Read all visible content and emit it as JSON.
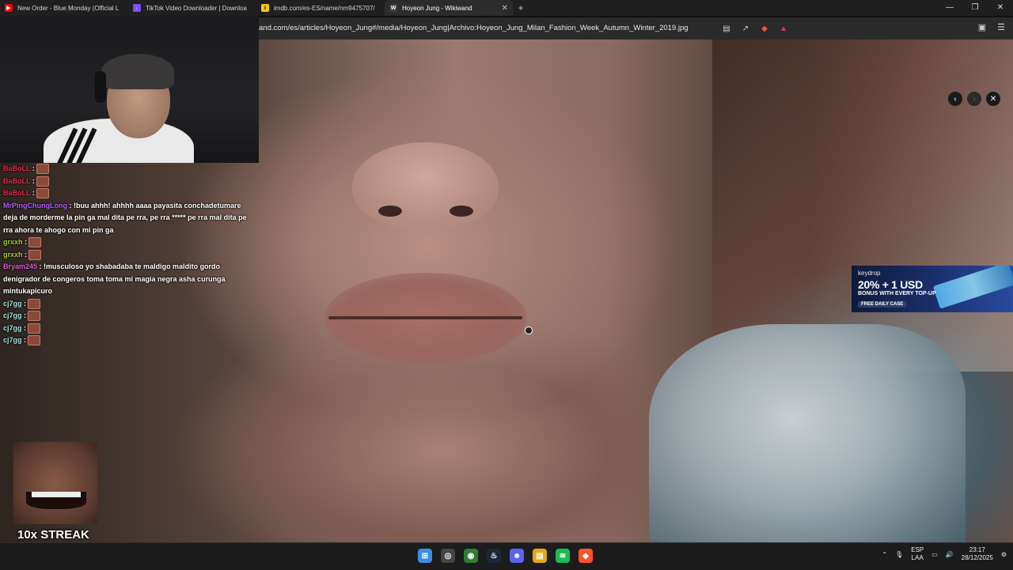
{
  "tabs": [
    {
      "title": "New Order - Blue Monday (Official L",
      "favicon": "youtube-icon",
      "color": "#ff0000"
    },
    {
      "title": "TikTok Video Downloader | Downloa",
      "favicon": "download-icon",
      "color": "#7b4bff"
    },
    {
      "title": "imdb.com/es-ES/name/nm9475707/",
      "favicon": "imdb-icon",
      "color": "#f5c518"
    },
    {
      "title": "Hoyeon Jung - Wikiwand",
      "favicon": "wikiwand-icon",
      "color": "#3c3c3c",
      "active": true
    }
  ],
  "address_bar": {
    "url": "and.com/es/articles/Hoyeon_Jung#/media/Hoyeon_Jung|Archivo:Hoyeon_Jung_Milan_Fashion_Week_Autumn_Winter_2019.jpg"
  },
  "chat": {
    "messages": [
      {
        "user": "BaBoLL",
        "color": "#e0294f",
        "text": " :"
      },
      {
        "user": "BaBoLL",
        "color": "#e0294f",
        "text": " :"
      },
      {
        "user": "BaBoLL",
        "color": "#e0294f",
        "text": " :"
      },
      {
        "user": "MrPingChungLong",
        "color": "#b45cff",
        "text": " : !buu ahhh! ahhhh aaaa payasita conchadetumare deja de morderme la pin ga mal dita pe rra, pe rra ***** pe rra mal dita pe rra ahora te ahogo con mi pin ga"
      },
      {
        "user": "grxxh",
        "color": "#9acd32",
        "text": " :"
      },
      {
        "user": "grxxh",
        "color": "#9acd32",
        "text": " :"
      },
      {
        "user": "Bryam245",
        "color": "#d95fd3",
        "text": " : !musculoso yo shabadaba te maldigo maldito gordo denigrador de congeros toma toma mi magia negra asha curunga mintukapicuro"
      },
      {
        "user": "cj7gg",
        "color": "#a7e3e0",
        "text": " :"
      },
      {
        "user": "cj7gg",
        "color": "#a7e3e0",
        "text": " :"
      },
      {
        "user": "cj7gg",
        "color": "#a7e3e0",
        "text": " :"
      },
      {
        "user": "cj7gg",
        "color": "#a7e3e0",
        "text": " :"
      }
    ]
  },
  "streak": {
    "label": "10x STREAK"
  },
  "ad": {
    "brand": "keydrop",
    "headline": "20% + 1 USD",
    "subline": "BONUS WITH EVERY TOP-UP",
    "cta": "FREE DAILY CASE"
  },
  "taskbar": {
    "apps": [
      {
        "name": "start-icon",
        "color": "#3a8ee6",
        "glyph": "⊞"
      },
      {
        "name": "steelseries-icon",
        "color": "#444",
        "glyph": "◎"
      },
      {
        "name": "chrome-icon",
        "color": "#2e7d32",
        "glyph": "◉"
      },
      {
        "name": "steam-icon",
        "color": "#1b2838",
        "glyph": "♨"
      },
      {
        "name": "discord-icon",
        "color": "#5865f2",
        "glyph": "☻"
      },
      {
        "name": "file-explorer-icon",
        "color": "#e6a817",
        "glyph": "▤"
      },
      {
        "name": "spotify-icon",
        "color": "#1db954",
        "glyph": "≋"
      },
      {
        "name": "brave-icon",
        "color": "#fb542b",
        "glyph": "◆"
      }
    ],
    "lang_top": "ESP",
    "lang_bottom": "LAA",
    "time": "23:17",
    "date": "28/12/2025"
  }
}
